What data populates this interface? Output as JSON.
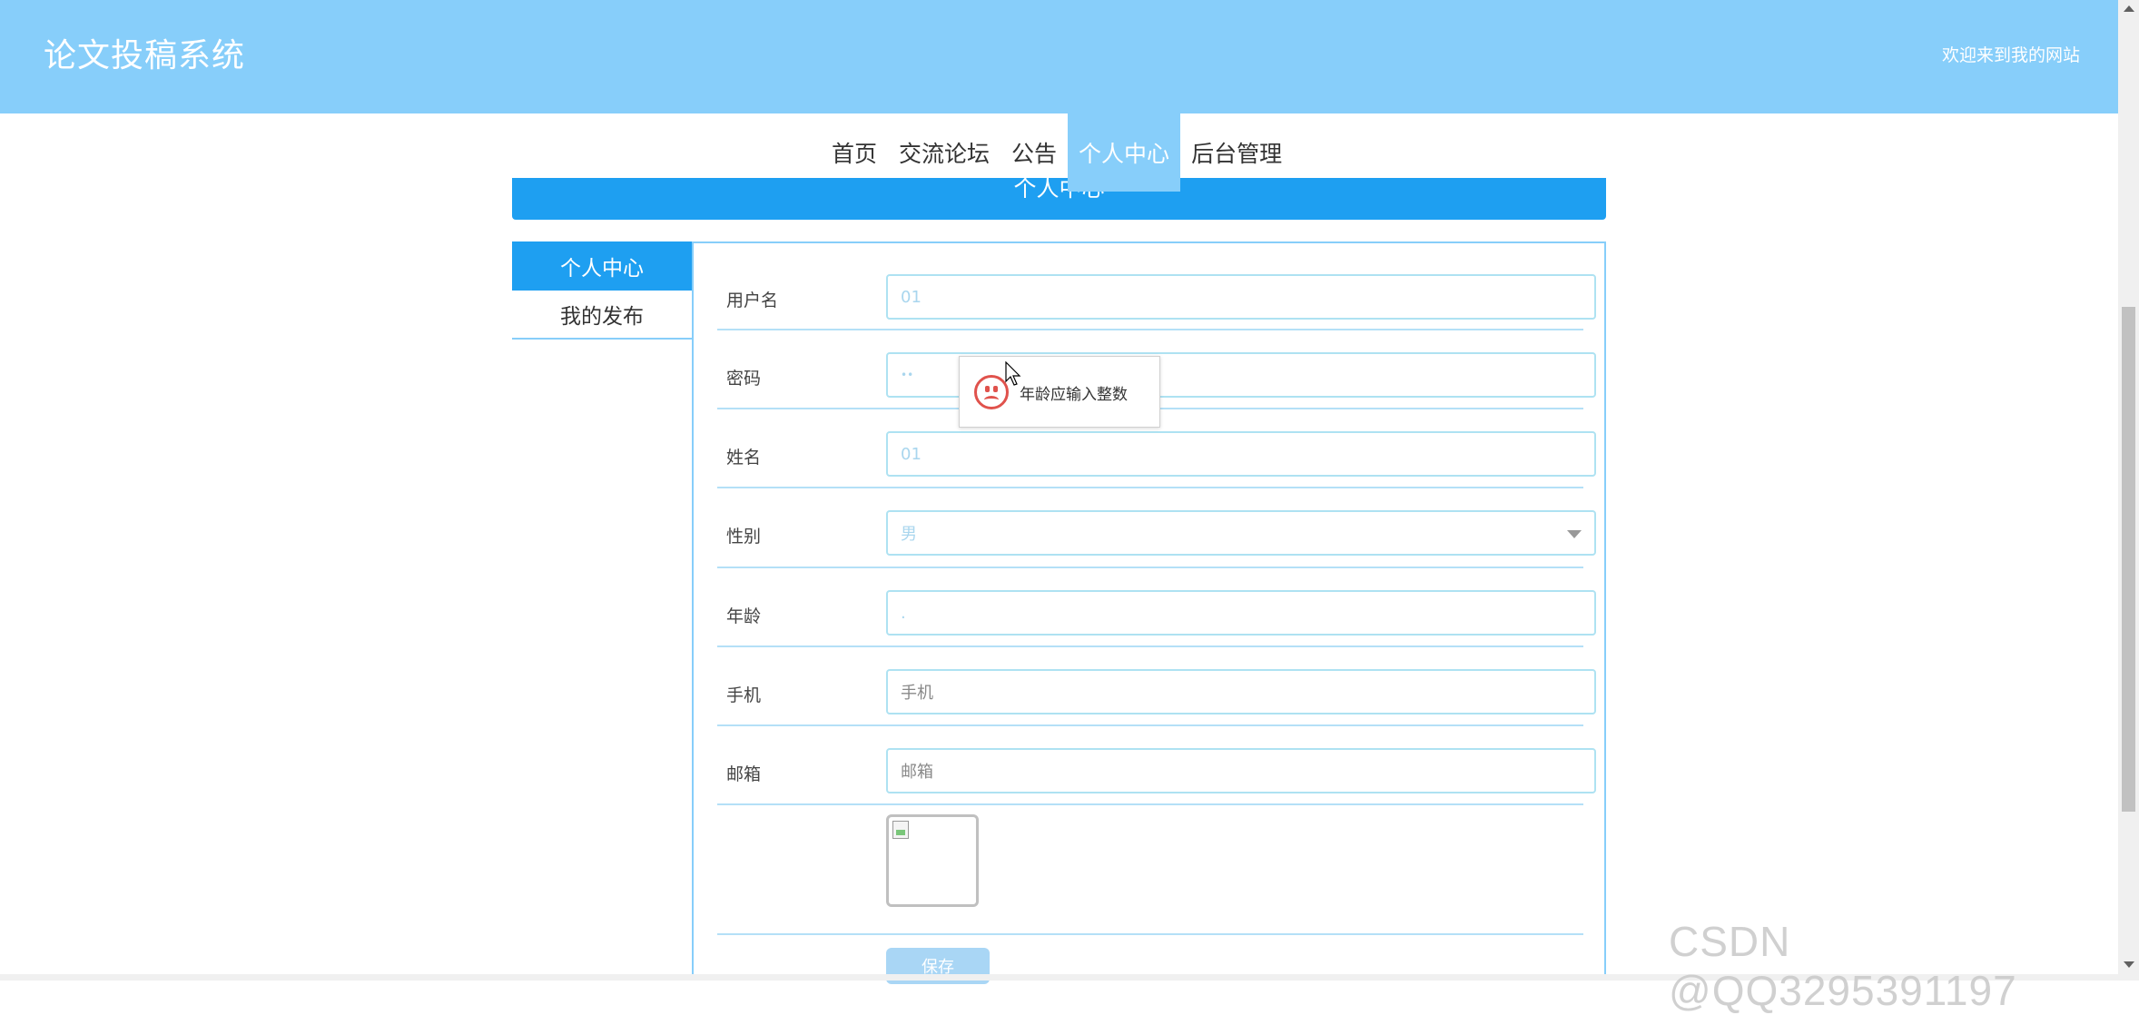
{
  "header": {
    "site_title": "论文投稿系统",
    "welcome": "欢迎来到我的网站"
  },
  "nav": {
    "items": [
      {
        "label": "首页",
        "active": false
      },
      {
        "label": "交流论坛",
        "active": false
      },
      {
        "label": "公告",
        "active": false
      },
      {
        "label": "个人中心",
        "active": true
      },
      {
        "label": "后台管理",
        "active": false
      }
    ]
  },
  "section_title": "个人中心",
  "sidebar": {
    "items": [
      {
        "label": "个人中心",
        "active": true
      },
      {
        "label": "我的发布",
        "active": false
      }
    ]
  },
  "form": {
    "username": {
      "label": "用户名",
      "value": "01"
    },
    "password": {
      "label": "密码",
      "value": "••"
    },
    "name": {
      "label": "姓名",
      "value": "01"
    },
    "gender": {
      "label": "性别",
      "value": "男"
    },
    "age": {
      "label": "年龄",
      "value": "."
    },
    "phone": {
      "label": "手机",
      "placeholder": "手机"
    },
    "email": {
      "label": "邮箱",
      "placeholder": "邮箱"
    },
    "submit_label": "保存"
  },
  "toast": {
    "message": "年龄应输入整数",
    "icon": "sad-face-icon"
  },
  "watermark": "CSDN @QQ3295391197",
  "colors": {
    "header_bg": "#87cefa",
    "accent": "#1e9ff1",
    "input_border": "#aee2f2",
    "error": "#e0524c"
  }
}
